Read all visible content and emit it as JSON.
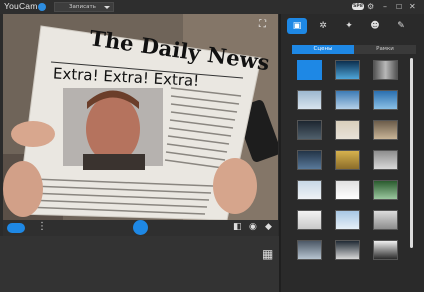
{
  "app": {
    "title": "YouCam"
  },
  "titlebar": {
    "record_dropdown": "Записать",
    "hd_badge": "SP8"
  },
  "right_panel": {
    "tabs": [
      "Сцены",
      "Рамки"
    ]
  },
  "newspaper": {
    "masthead": "The Daily News",
    "headline": "Extra! Extra! Extra!"
  },
  "icons": {
    "titlebar": [
      "settings-icon",
      "minimize-icon",
      "maximize-icon",
      "close-icon"
    ],
    "panel_top": [
      "scenes-icon",
      "effects-icon",
      "magic-icon",
      "avatar-icon",
      "brush-icon"
    ],
    "controls": [
      "camera-mode-icon",
      "more-icon",
      "capture-icon",
      "pip-icon",
      "eye-icon",
      "eraser-icon",
      "grid-icon"
    ]
  },
  "colors": {
    "accent": "#1e88e5",
    "panel_bg": "#2a2a2a"
  }
}
